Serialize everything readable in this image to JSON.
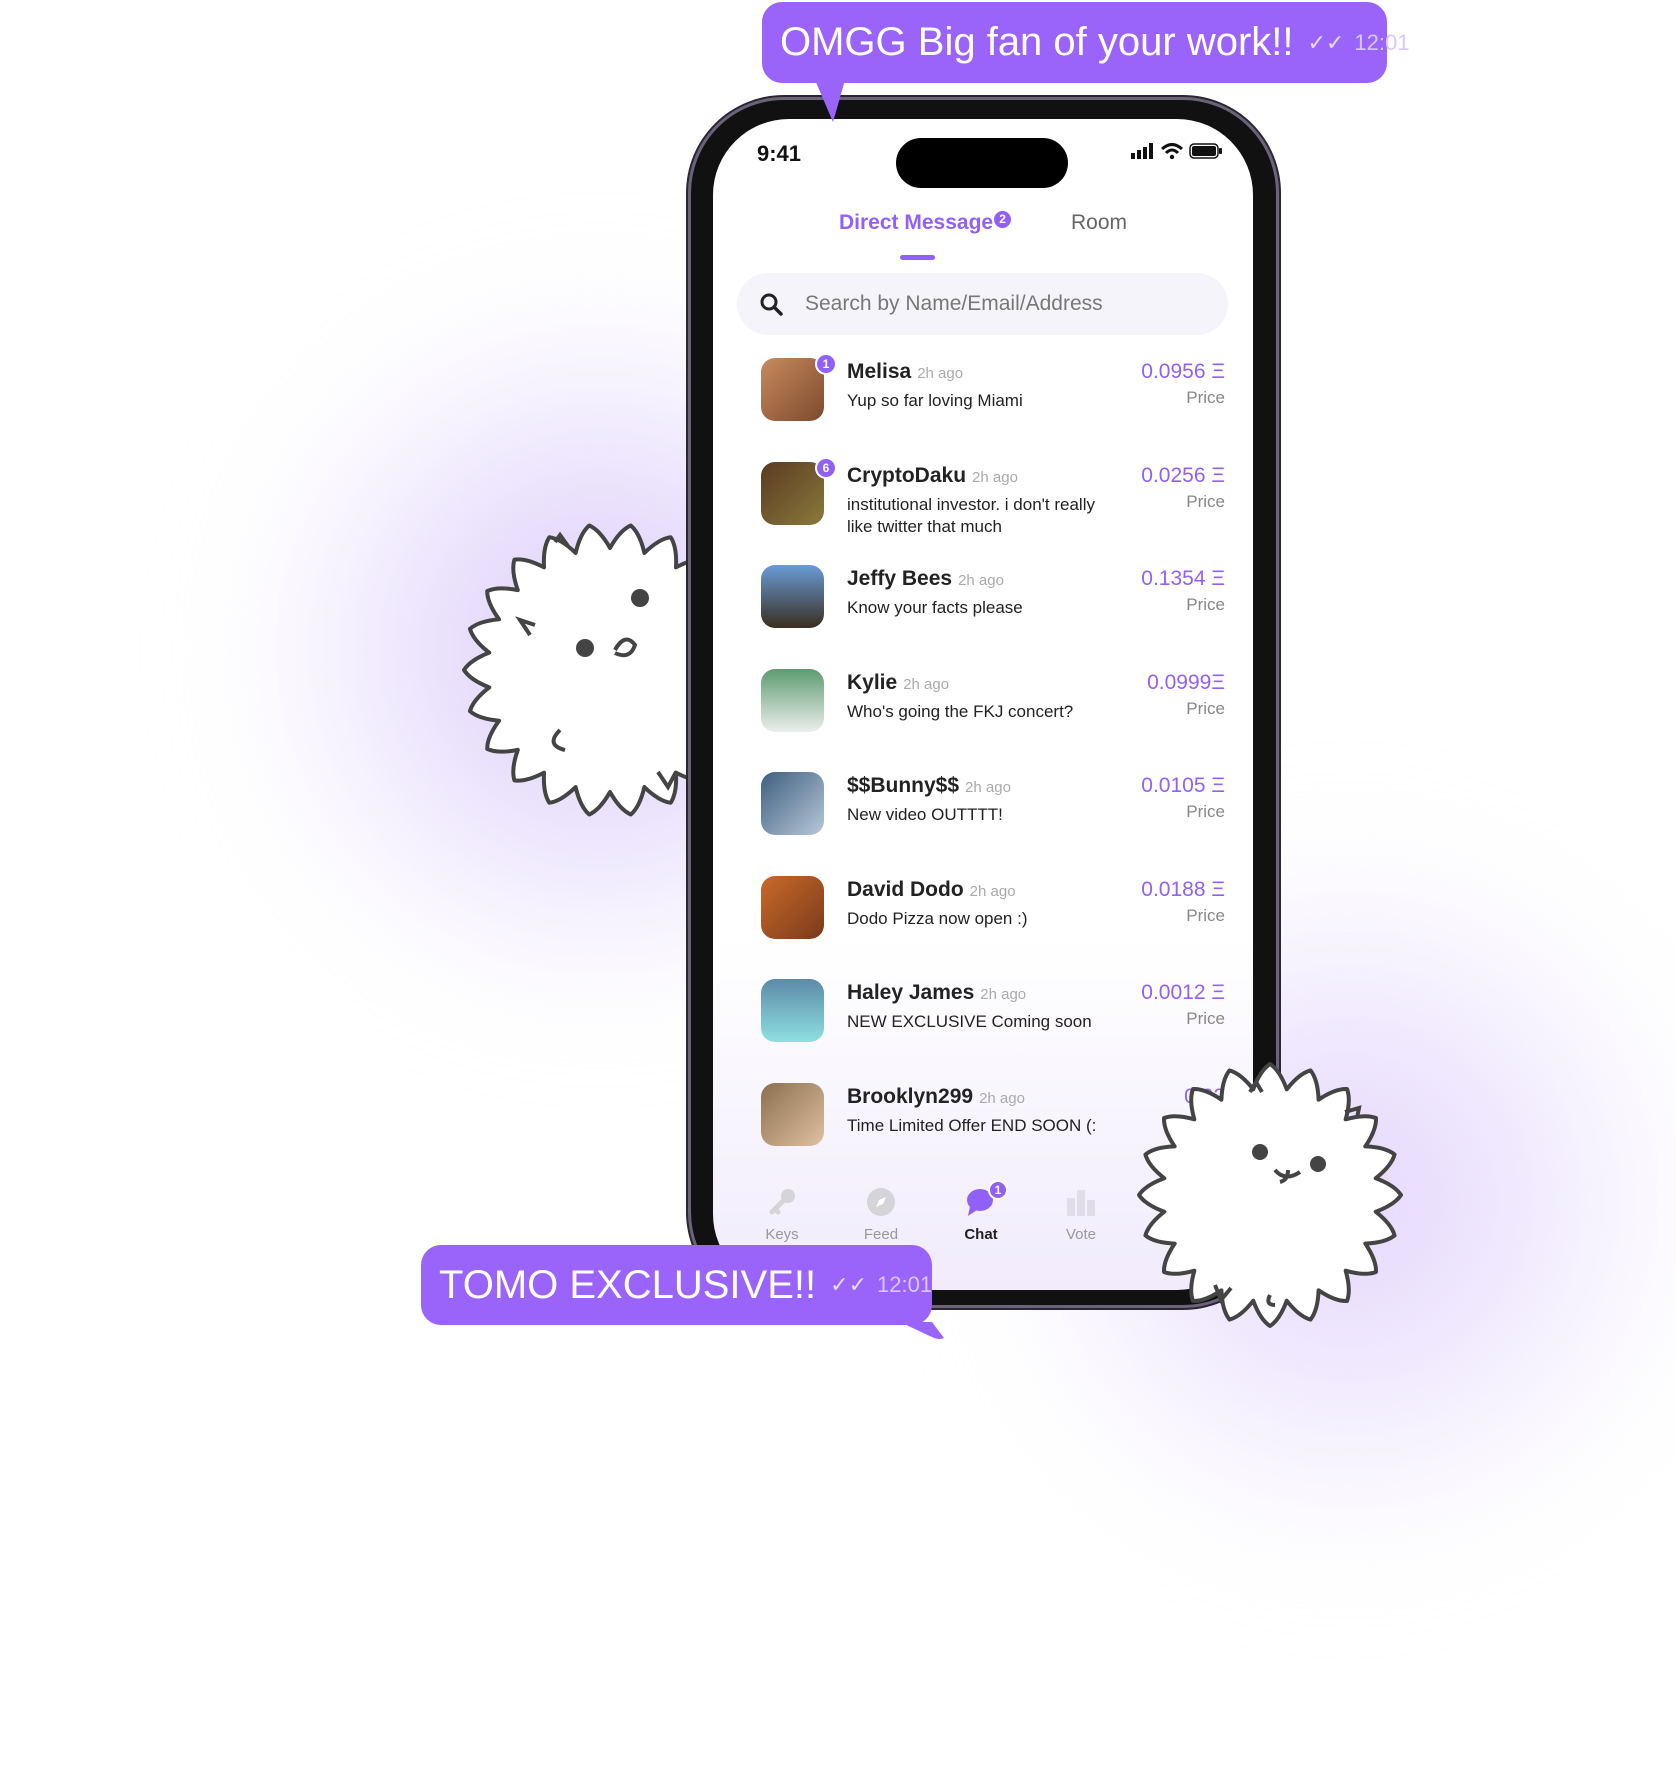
{
  "colors": {
    "accent": "#9161f7",
    "bubble": "#9a64fb"
  },
  "status_bar": {
    "time": "9:41",
    "icons": [
      "signal-icon",
      "wifi-icon",
      "battery-icon"
    ]
  },
  "tabs": [
    {
      "label": "Direct Message",
      "badge": "2",
      "active": true
    },
    {
      "label": "Room",
      "active": false
    }
  ],
  "search": {
    "placeholder": "Search by Name/Email/Address",
    "value": ""
  },
  "conversations": [
    {
      "name": "Melisa",
      "time": "2h ago",
      "message": "Yup so far loving Miami",
      "price": "0.0956 Ξ",
      "price_label": "Price",
      "unread": "1"
    },
    {
      "name": "CryptoDaku",
      "time": "2h ago",
      "message": "institutional investor. i don't really like twitter that much",
      "price": "0.0256 Ξ",
      "price_label": "Price",
      "unread": "6"
    },
    {
      "name": "Jeffy Bees",
      "time": "2h ago",
      "message": "Know your facts please",
      "price": "0.1354 Ξ",
      "price_label": "Price"
    },
    {
      "name": "Kylie",
      "time": "2h ago",
      "message": "Who's going the FKJ concert?",
      "price": "0.0999Ξ",
      "price_label": "Price"
    },
    {
      "name": "$$Bunny$$",
      "time": "2h ago",
      "message": "New video OUTTTT!",
      "price": "0.0105 Ξ",
      "price_label": "Price"
    },
    {
      "name": "David Dodo",
      "time": "2h ago",
      "message": "Dodo Pizza now open :)",
      "price": "0.0188 Ξ",
      "price_label": "Price"
    },
    {
      "name": "Haley James",
      "time": "2h ago",
      "message": "NEW EXCLUSIVE Coming soon",
      "price": "0.0012 Ξ",
      "price_label": "Price"
    },
    {
      "name": "Brooklyn299",
      "time": "2h ago",
      "message": "Time Limited Offer END SOON (:",
      "price": "0.02"
    }
  ],
  "bottom_nav": [
    {
      "label": "Keys",
      "icon": "key-icon"
    },
    {
      "label": "Feed",
      "icon": "compass-icon"
    },
    {
      "label": "Chat",
      "icon": "chat-icon",
      "badge": "1",
      "active": true
    },
    {
      "label": "Vote",
      "icon": "podium-icon"
    }
  ],
  "bubbles": {
    "top": {
      "text": "OMGG Big fan of your work!!",
      "time": "12:01"
    },
    "bottom": {
      "text": "TOMO EXCLUSIVE!!",
      "time": "12:01"
    }
  }
}
